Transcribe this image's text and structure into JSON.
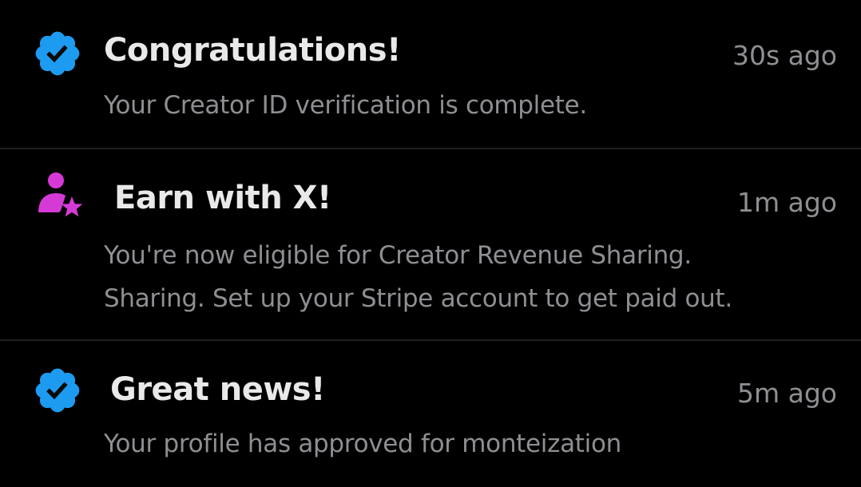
{
  "colors": {
    "background": "#000000",
    "title": "#e9e9ea",
    "secondary_text": "#8e8f93",
    "divider": "#1f1f22",
    "verified_blue": "#1d9bf0",
    "creator_pink": "#d63ad6"
  },
  "notifications": [
    {
      "icon": "verified-badge-icon",
      "title": "Congratulations!",
      "time": "30s ago",
      "body_lines": [
        "Your Creator ID verification is complete."
      ]
    },
    {
      "icon": "creator-star-icon",
      "title": "Earn with X!",
      "time": "1m ago",
      "body_lines": [
        "You're now eligible for Creator Revenue Sharing.",
        "Sharing. Set up your Stripe account to get paid out."
      ]
    },
    {
      "icon": "verified-badge-icon",
      "title": "Great news!",
      "time": "5m ago",
      "body_lines": [
        "Your profile has approved for monteization"
      ]
    }
  ]
}
